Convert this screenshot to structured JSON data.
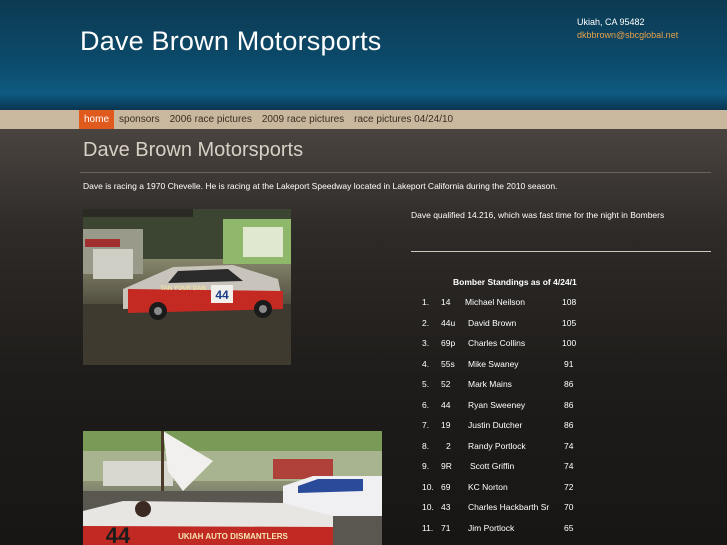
{
  "site": {
    "title": "Dave Brown Motorsports",
    "address": "Ukiah, CA 95482",
    "email": "dkbbrown@sbcglobal.net"
  },
  "nav": {
    "items": [
      {
        "label": "home",
        "active": true
      },
      {
        "label": "sponsors"
      },
      {
        "label": "2006 race pictures"
      },
      {
        "label": "2009 race pictures"
      },
      {
        "label": "race pictures 04/24/10"
      }
    ]
  },
  "main": {
    "title": "Dave Brown Motorsports",
    "intro": "Dave is racing a 1970 Chevelle.  He is racing at the Lakeport Speedway located in Lakeport California during the 2010 season.",
    "qualified": "Dave qualified 14.216, which was fast time for the night in Bombers"
  },
  "photos": {
    "car1_number": "44",
    "car1_sign": "TAN YOUR DAN",
    "car2_number": "44",
    "car2_sign": "UKIAH AUTO DISMANTLERS"
  },
  "standings": {
    "heading": "Bomber Standings as of  4/24/1",
    "rows": [
      {
        "pos": "1.",
        "car": "14",
        "driver": "Michael Neilson",
        "points": "108"
      },
      {
        "pos": "2.",
        "car": "44u",
        "driver": "David Brown",
        "points": "105"
      },
      {
        "pos": "3.",
        "car": "69p",
        "driver": "Charles Collins",
        "points": "100"
      },
      {
        "pos": "4.",
        "car": "55s",
        "driver": "Mike Swaney",
        "points": "91"
      },
      {
        "pos": "5.",
        "car": "52",
        "driver": "Mark Mains",
        "points": "86"
      },
      {
        "pos": "6.",
        "car": "44",
        "driver": "Ryan Sweeney",
        "points": "86"
      },
      {
        "pos": "7.",
        "car": "19",
        "driver": "Justin Dutcher",
        "points": "86"
      },
      {
        "pos": "8.",
        "car": "2",
        "driver": "Randy Portlock",
        "points": "74"
      },
      {
        "pos": "9.",
        "car": "9R",
        "driver": "Scott Griffin",
        "points": "74"
      },
      {
        "pos": "10.",
        "car": "69",
        "driver": "KC Norton",
        "points": "72"
      },
      {
        "pos": "10.",
        "car": "43",
        "driver": "Charles Hackbarth Sr",
        "points": "70"
      },
      {
        "pos": "11.",
        "car": "71",
        "driver": "Jim Portlock",
        "points": "65"
      }
    ]
  }
}
